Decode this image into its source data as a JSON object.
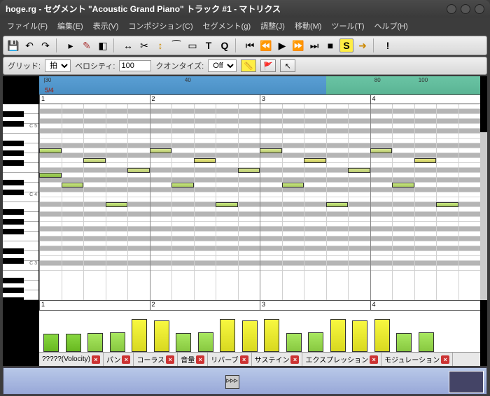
{
  "title": "hoge.rg - セグメント \"Acoustic Grand Piano\" トラック #1 - マトリクス",
  "menu": [
    "ファイル(F)",
    "編集(E)",
    "表示(V)",
    "コンポジション(C)",
    "セグメント(g)",
    "調整(J)",
    "移動(M)",
    "ツール(T)",
    "ヘルプ(H)"
  ],
  "options": {
    "grid_label": "グリッド:",
    "grid_value": "拍",
    "velocity_label": "ベロシティ:",
    "velocity_value": "100",
    "quantize_label": "クオンタイズ:",
    "quantize_value": "Off"
  },
  "time_sig": "5/4",
  "top_markers": [
    "|30",
    "40",
    "80",
    "100"
  ],
  "ruler_bars": [
    "1",
    "2",
    "3",
    "4"
  ],
  "key_labels": {
    "c5": "C 5",
    "c4": "C 4",
    "c3": "C 3"
  },
  "tabs": [
    "?????(Volocity)",
    "パン",
    "コーラス",
    "音量",
    "リバーブ",
    "サステイン",
    "エクスプレッション",
    "モジュレーション"
  ],
  "chart_data": {
    "type": "bar",
    "title": "Velocity",
    "ylim": [
      0,
      127
    ],
    "values": [
      55,
      55,
      58,
      60,
      100,
      95,
      58,
      60,
      100,
      95,
      100,
      58,
      60,
      100,
      95,
      100,
      58,
      60
    ]
  },
  "notes": [
    {
      "bar": 0,
      "beat": 0,
      "pitch": 14,
      "len": 1,
      "cls": "g1"
    },
    {
      "bar": 0,
      "beat": 0,
      "pitch": 19,
      "len": 1,
      "cls": "g2"
    },
    {
      "bar": 0,
      "beat": 1,
      "pitch": 12,
      "len": 1,
      "cls": "g2"
    },
    {
      "bar": 0,
      "beat": 2,
      "pitch": 17,
      "len": 1,
      "cls": "g3"
    },
    {
      "bar": 0,
      "beat": 3,
      "pitch": 8,
      "len": 1,
      "cls": "g2"
    },
    {
      "bar": 0,
      "beat": 4,
      "pitch": 15,
      "len": 1,
      "cls": "g3"
    },
    {
      "bar": 1,
      "beat": 0,
      "pitch": 19,
      "len": 1,
      "cls": "g3"
    },
    {
      "bar": 1,
      "beat": 1,
      "pitch": 12,
      "len": 1,
      "cls": "g2"
    },
    {
      "bar": 1,
      "beat": 2,
      "pitch": 17,
      "len": 1,
      "cls": "y1"
    },
    {
      "bar": 1,
      "beat": 3,
      "pitch": 8,
      "len": 1,
      "cls": "g2"
    },
    {
      "bar": 1,
      "beat": 4,
      "pitch": 15,
      "len": 1,
      "cls": "g3"
    },
    {
      "bar": 2,
      "beat": 0,
      "pitch": 19,
      "len": 1,
      "cls": "g3"
    },
    {
      "bar": 2,
      "beat": 1,
      "pitch": 12,
      "len": 1,
      "cls": "g2"
    },
    {
      "bar": 2,
      "beat": 2,
      "pitch": 17,
      "len": 1,
      "cls": "y1"
    },
    {
      "bar": 2,
      "beat": 3,
      "pitch": 8,
      "len": 1,
      "cls": "g2"
    },
    {
      "bar": 2,
      "beat": 4,
      "pitch": 15,
      "len": 1,
      "cls": "g3"
    },
    {
      "bar": 3,
      "beat": 0,
      "pitch": 19,
      "len": 1,
      "cls": "g3"
    },
    {
      "bar": 3,
      "beat": 1,
      "pitch": 12,
      "len": 1,
      "cls": "g2"
    },
    {
      "bar": 3,
      "beat": 2,
      "pitch": 17,
      "len": 1,
      "cls": "y1"
    },
    {
      "bar": 3,
      "beat": 3,
      "pitch": 8,
      "len": 1,
      "cls": "g2"
    }
  ]
}
